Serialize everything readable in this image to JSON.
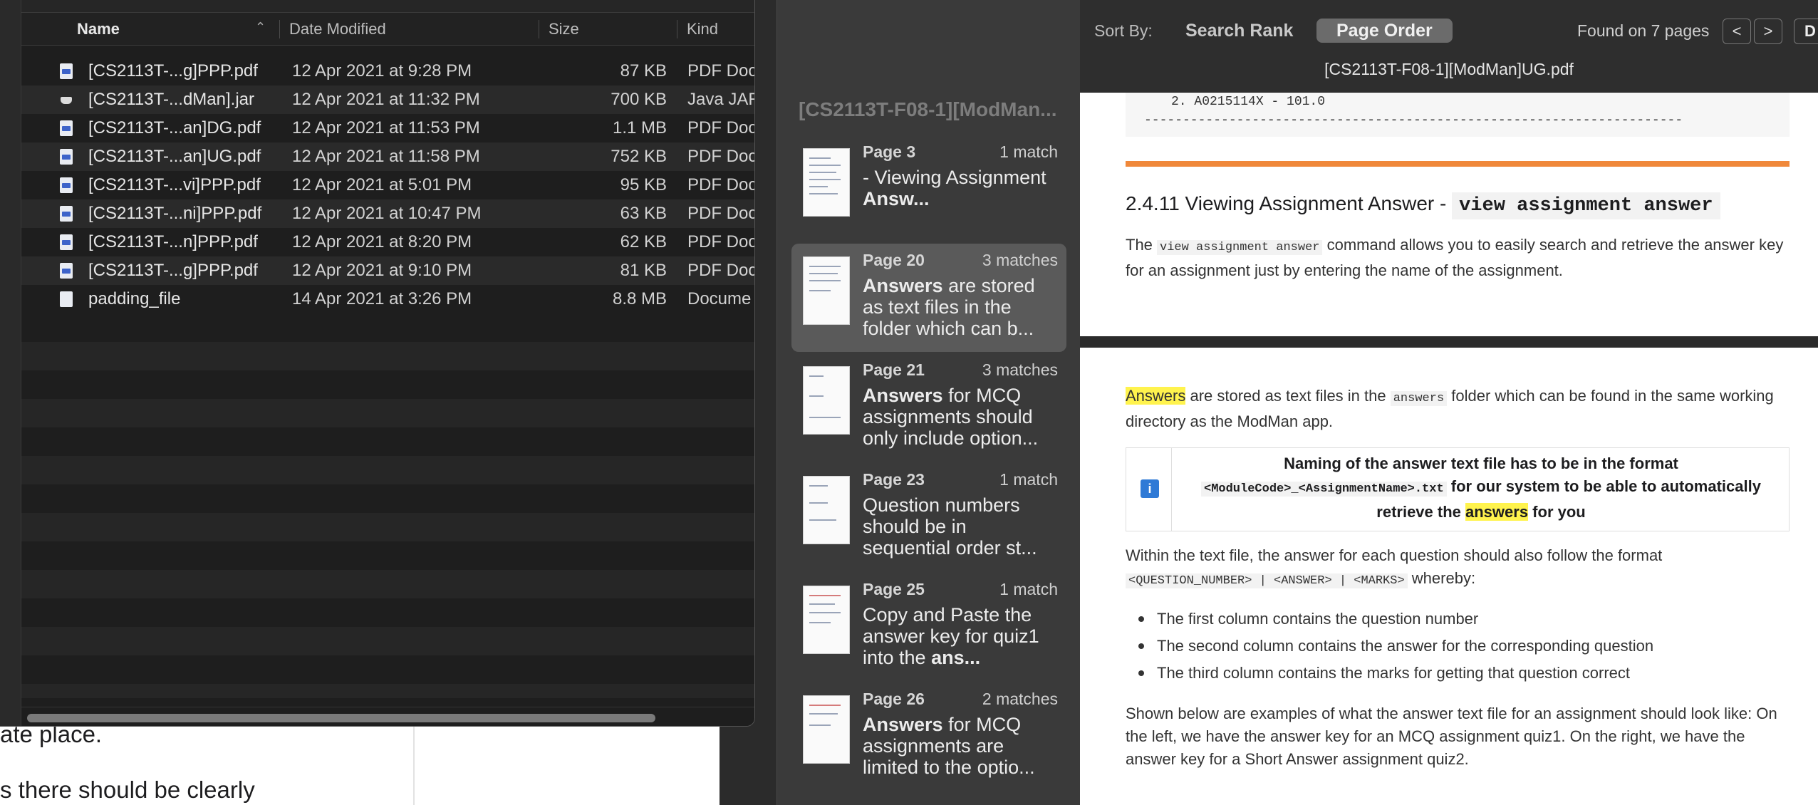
{
  "background_doc": {
    "line1": "ate place.",
    "line2": "s there should be clearly"
  },
  "finder": {
    "columns": {
      "name": "Name",
      "date": "Date Modified",
      "size": "Size",
      "kind": "Kind"
    },
    "files": [
      {
        "name": "[CS2113T-...g]PPP.pdf",
        "date": "12 Apr 2021 at 9:28 PM",
        "size": "87 KB",
        "kind": "PDF Doc",
        "icon": "pdf-file-icon"
      },
      {
        "name": "[CS2113T-...dMan].jar",
        "date": "12 Apr 2021 at 11:32 PM",
        "size": "700 KB",
        "kind": "Java JAR",
        "icon": "jar-file-icon"
      },
      {
        "name": "[CS2113T-...an]DG.pdf",
        "date": "12 Apr 2021 at 11:53 PM",
        "size": "1.1 MB",
        "kind": "PDF Doc",
        "icon": "pdf-file-icon"
      },
      {
        "name": "[CS2113T-...an]UG.pdf",
        "date": "12 Apr 2021 at 11:58 PM",
        "size": "752 KB",
        "kind": "PDF Doc",
        "icon": "pdf-file-icon"
      },
      {
        "name": "[CS2113T-...vi]PPP.pdf",
        "date": "12 Apr 2021 at 5:01 PM",
        "size": "95 KB",
        "kind": "PDF Doc",
        "icon": "pdf-file-icon"
      },
      {
        "name": "[CS2113T-...ni]PPP.pdf",
        "date": "12 Apr 2021 at 10:47 PM",
        "size": "63 KB",
        "kind": "PDF Doc",
        "icon": "pdf-file-icon"
      },
      {
        "name": "[CS2113T-...n]PPP.pdf",
        "date": "12 Apr 2021 at 8:20 PM",
        "size": "62 KB",
        "kind": "PDF Doc",
        "icon": "pdf-file-icon"
      },
      {
        "name": "[CS2113T-...g]PPP.pdf",
        "date": "12 Apr 2021 at 9:10 PM",
        "size": "81 KB",
        "kind": "PDF Doc",
        "icon": "pdf-file-icon"
      },
      {
        "name": "padding_file",
        "date": "14 Apr 2021 at 3:26 PM",
        "size": "8.8 MB",
        "kind": "Docume",
        "icon": "document-file-icon"
      }
    ]
  },
  "preview_sidebar": {
    "doc_title": "[CS2113T-F08-1][ModMan...",
    "results": [
      {
        "page": "Page 3",
        "count": "1 match",
        "pre": "- Viewing Assignment ",
        "bold": "Answ...",
        "post": "",
        "selected": false
      },
      {
        "page": "Page 20",
        "count": "3 matches",
        "pre": "",
        "bold": "Answers",
        "post": " are stored as text files in the folder which can b...",
        "selected": true
      },
      {
        "page": "Page 21",
        "count": "3 matches",
        "pre": "",
        "bold": "Answers",
        "post": " for MCQ assignments should only include option...",
        "selected": false
      },
      {
        "page": "Page 23",
        "count": "1 match",
        "pre": "Question numbers should be in sequential order st...",
        "bold": "",
        "post": "",
        "selected": false
      },
      {
        "page": "Page 25",
        "count": "1 match",
        "pre": "Copy and Paste the answer key for quiz1 into the ",
        "bold": "ans...",
        "post": "",
        "selected": false
      },
      {
        "page": "Page 26",
        "count": "2 matches",
        "pre": "",
        "bold": "Answers",
        "post": " for MCQ assignments are limited to the optio...",
        "selected": false
      }
    ]
  },
  "toolbar": {
    "sort_by": "Sort By:",
    "search_rank": "Search Rank",
    "page_order": "Page Order",
    "found": "Found on 7 pages",
    "prev": "<",
    "next": ">",
    "done": "D",
    "doc_title": "[CS2113T-F08-1][ModMan]UG.pdf"
  },
  "document": {
    "code_line1": "2. A0215114X - 101.0",
    "code_line2": "----------------------------------------------------------------------",
    "heading_text": "2.4.11 Viewing Assignment Answer - ",
    "heading_code": "view assignment answer",
    "intro_pre": "The ",
    "intro_code": "view assignment answer",
    "intro_post": " command allows you to easily search and retrieve the answer key for an assignment just by entering the name of the assignment.",
    "p2_hl": "Answers",
    "p2_mid": " are stored as text files in the ",
    "p2_code_hl": "answers",
    "p2_post": " folder which can be found in the same working directory as the ModMan app.",
    "note_line1": "Naming of the answer text file has to be in the format",
    "note_code": "<ModuleCode>_<AssignmentName>.txt",
    "note_mid": " for our system to be able to automatically retrieve the ",
    "note_hl": "answers",
    "note_end": " for you",
    "p3_text": "Within the text file, the answer for each question should also follow the format",
    "p3_code": "<QUESTION_NUMBER> | <ANSWER> | <MARKS>",
    "p3_post": " whereby:",
    "bullets": [
      "The first column contains the question number",
      "The second column contains the answer for the corresponding question",
      "The third column contains the marks for getting that question correct"
    ],
    "p4": "Shown below are examples of what the answer text file for an assignment should look like: On the left, we have the answer key for an MCQ assignment quiz1. On the right, we have the answer key for a Short Answer assignment quiz2."
  }
}
